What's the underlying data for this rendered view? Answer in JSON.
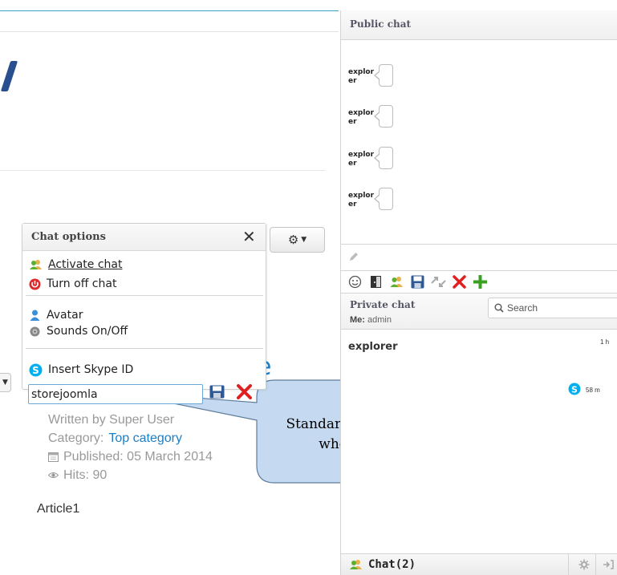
{
  "article": {
    "title_fragment": "e",
    "author": "Written by Super User",
    "category_label": "Category:",
    "category_link": "Top category",
    "published": "Published: 05 March 2014",
    "hits": "Hits: 90",
    "body": "Article1"
  },
  "chat_options": {
    "title": "Chat options",
    "close": "✕",
    "items": [
      {
        "label": "Activate chat",
        "icon": "users-icon"
      },
      {
        "label": "Turn off chat",
        "icon": "power-icon"
      },
      {
        "label": "Avatar",
        "icon": "avatar-icon"
      },
      {
        "label": "Sounds On/Off",
        "icon": "speaker-icon"
      },
      {
        "label": "Insert Skype ID",
        "icon": "skype-icon"
      }
    ],
    "skype_value": "storejoomla"
  },
  "callout": {
    "line1": "Standard Skype ID chosen",
    "line2": "when registering"
  },
  "public_chat": {
    "title": "Public chat",
    "messages": [
      {
        "user": "explorer"
      },
      {
        "user": "explorer"
      },
      {
        "user": "explorer"
      },
      {
        "user": "explorer"
      }
    ]
  },
  "private_chat": {
    "title": "Private chat",
    "me_label": "Me:",
    "me_value": "admin",
    "search_placeholder": "Search",
    "users": [
      {
        "name": "explorer",
        "time": "1 h"
      },
      {
        "name": "",
        "time": "58 m"
      }
    ]
  },
  "footer": {
    "chat_label": "Chat(2)"
  },
  "colors": {
    "accent": "#1d7dc5",
    "skype": "#00aff0",
    "callout_fill": "#c5daf0",
    "delete": "#e02020",
    "add": "#3aa022"
  }
}
